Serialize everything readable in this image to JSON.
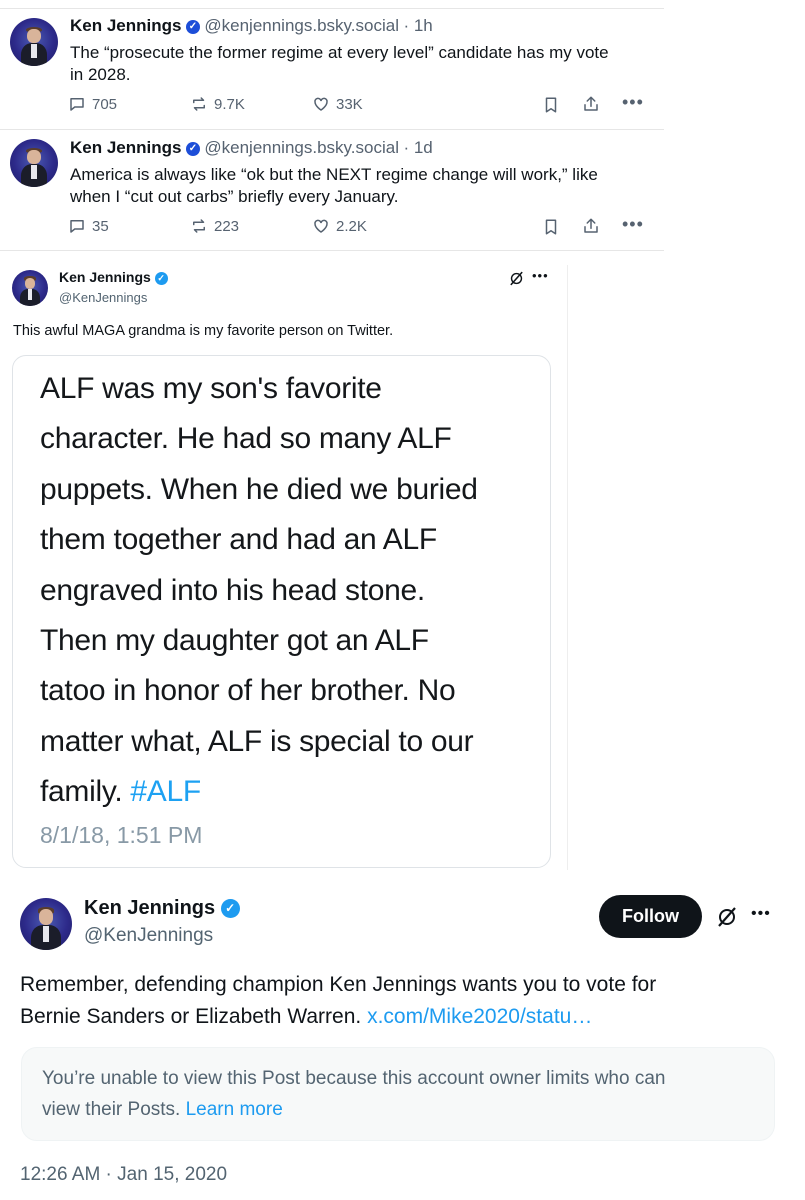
{
  "bsky_posts": [
    {
      "name": "Ken Jennings",
      "handle": "@kenjennings.bsky.social",
      "time": "· 1h",
      "text_line1": "The “prosecute the former regime at every level” candidate has my vote",
      "text_line2": "in 2028.",
      "replies": "705",
      "reposts": "9.7K",
      "likes": "33K"
    },
    {
      "name": "Ken Jennings",
      "handle": "@kenjennings.bsky.social",
      "time": "· 1d",
      "text_line1": "America is always like “ok but the NEXT regime change will work,” like",
      "text_line2": "when I “cut out carbs” briefly every January.",
      "replies": "35",
      "reposts": "223",
      "likes": "2.2K"
    }
  ],
  "tweet_quote": {
    "name": "Ken Jennings",
    "handle": "@KenJennings",
    "text": "This awful MAGA grandma is my favorite person on Twitter.",
    "image_lines": [
      "ALF was my son's favorite",
      "character. He had so many ALF",
      "puppets. When he died we buried",
      "them together and had an ALF",
      "engraved into his head stone.",
      "Then my daughter got an ALF",
      "tatoo in honor of her brother. No",
      "matter what, ALF is special to our"
    ],
    "image_last_line_text": "family.",
    "image_hashtag": "#ALF",
    "image_timestamp": "8/1/18, 1:51 PM"
  },
  "tweet_main": {
    "name": "Ken Jennings",
    "handle": "@KenJennings",
    "follow_label": "Follow",
    "text_line1": "Remember, defending champion Ken Jennings wants you to vote for",
    "text_line2": "Bernie Sanders or Elizabeth Warren.",
    "link": "x.com/Mike2020/statu…",
    "limited_line1": "You’re unable to view this Post because this account owner limits who can",
    "limited_line2": "view their Posts.",
    "learn_more": "Learn more",
    "timestamp": "12:26 AM · Jan 15, 2020"
  },
  "colors": {
    "link": "#1d9bf0",
    "verified": "#1d9bf0",
    "bsky_verified": "#1d4ed8",
    "follow_bg": "#0f1419"
  },
  "icons": [
    "reply-icon",
    "repost-icon",
    "like-icon",
    "bookmark-icon",
    "share-icon",
    "more-icon",
    "grok-icon",
    "verified-icon"
  ]
}
